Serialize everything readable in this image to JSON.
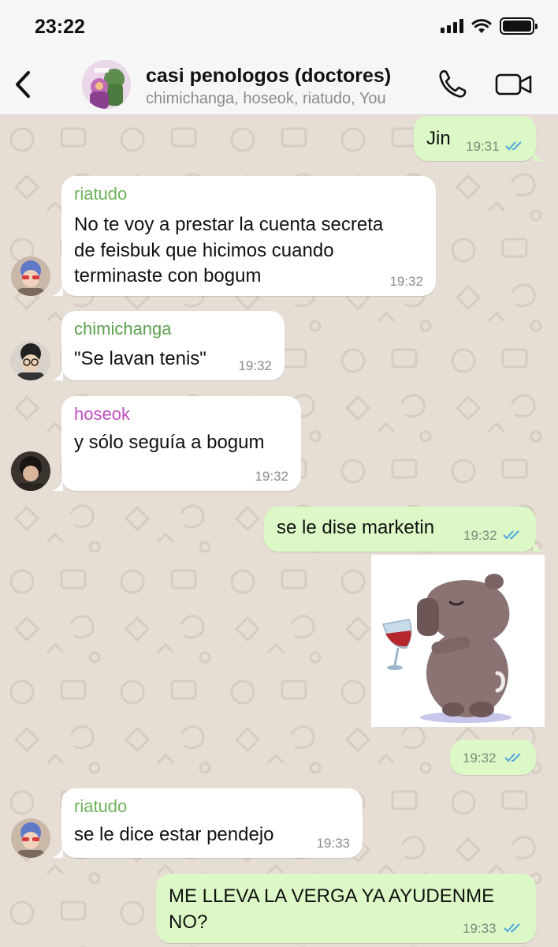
{
  "status_bar": {
    "time": "23:22"
  },
  "header": {
    "title": "casi penologos (doctores)",
    "members": "chimichanga, hoseok, riatudo, You"
  },
  "colors": {
    "outgoing_bubble": "#dcf8c6",
    "incoming_bubble": "#ffffff",
    "riatudo": "#6fb35a",
    "chimichanga": "#5aa14e",
    "hoseok": "#c04ec0",
    "read_ticks": "#4fa6e0"
  },
  "messages": [
    {
      "direction": "out",
      "text": "Jin",
      "time": "19:31",
      "read": true
    },
    {
      "direction": "in",
      "sender": "riatudo",
      "lines": [
        "No te voy a prestar la cuenta secreta",
        "de feisbuk que hicimos cuando",
        "terminaste con bogum"
      ],
      "time": "19:32"
    },
    {
      "direction": "in",
      "sender": "chimichanga",
      "text": "\"Se lavan tenis\"",
      "time": "19:32"
    },
    {
      "direction": "in",
      "sender": "hoseok",
      "text": "y sólo seguía a bogum",
      "time": "19:32"
    },
    {
      "direction": "out",
      "text": "se le dise marketin",
      "time": "19:32",
      "read": true
    },
    {
      "direction": "out",
      "type": "sticker",
      "sticker": "capybara-wine-sticker",
      "time": "19:32",
      "read": true
    },
    {
      "direction": "in",
      "sender": "riatudo",
      "text": "se le dice estar pendejo",
      "time": "19:33"
    },
    {
      "direction": "out",
      "lines": [
        "ME LLEVA LA VERGA YA AYUDENME",
        "NO?"
      ],
      "time": "19:33",
      "read": true
    }
  ],
  "icons": [
    "back-chevron-icon",
    "phone-icon",
    "video-call-icon",
    "signal-icon",
    "wifi-icon",
    "battery-icon",
    "read-ticks-icon"
  ]
}
